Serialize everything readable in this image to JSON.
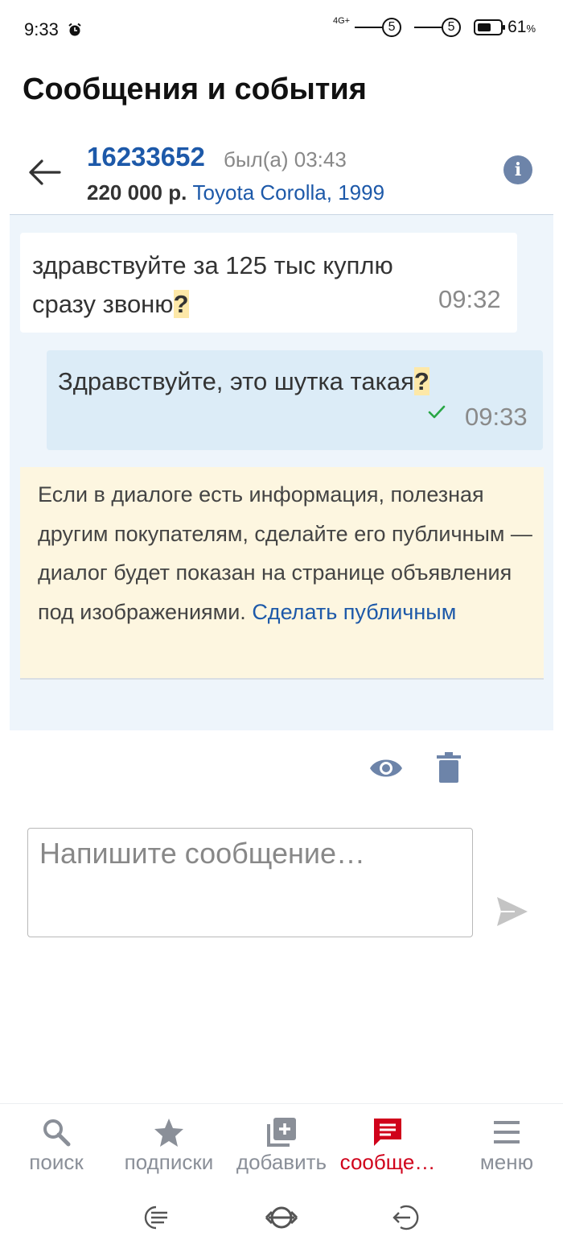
{
  "status_bar": {
    "time": "9:33",
    "network": "4G+",
    "sim1": "5",
    "sim2": "5",
    "battery_percent": "61",
    "battery_unit": "%",
    "battery_level": 0.61
  },
  "page_title": "Сообщения и события",
  "chat_header": {
    "user_id": "16233652",
    "last_seen": "был(а) 03:43",
    "price": "220 000 р.",
    "ad_title": "Toyota Corolla, 1999"
  },
  "messages": [
    {
      "text_before": "здравствуйте за 125 тыс куплю сразу звоню",
      "mark": "?",
      "time": "09:32"
    },
    {
      "text_before": "Здравствуйте, это шутка такая",
      "mark": "?",
      "time": "09:33"
    }
  ],
  "notice": {
    "text": "Если в диалоге есть информация, полезная другим покупателям, сделайте его публичным — диалог будет показан на странице объявления под изображениями. ",
    "link": "Сделать публичным"
  },
  "compose": {
    "placeholder": "Напишите сообщение…"
  },
  "bottom_nav": [
    {
      "label": "поиск",
      "icon": "search-icon"
    },
    {
      "label": "подписки",
      "icon": "star-icon"
    },
    {
      "label": "добавить",
      "icon": "add-box-icon"
    },
    {
      "label": "сообще…",
      "icon": "message-icon",
      "active": true
    },
    {
      "label": "меню",
      "icon": "menu-icon"
    }
  ],
  "colors": {
    "accent_blue": "#1d59a9",
    "active_red": "#d0021b",
    "icon_slate": "#6d84a9"
  }
}
